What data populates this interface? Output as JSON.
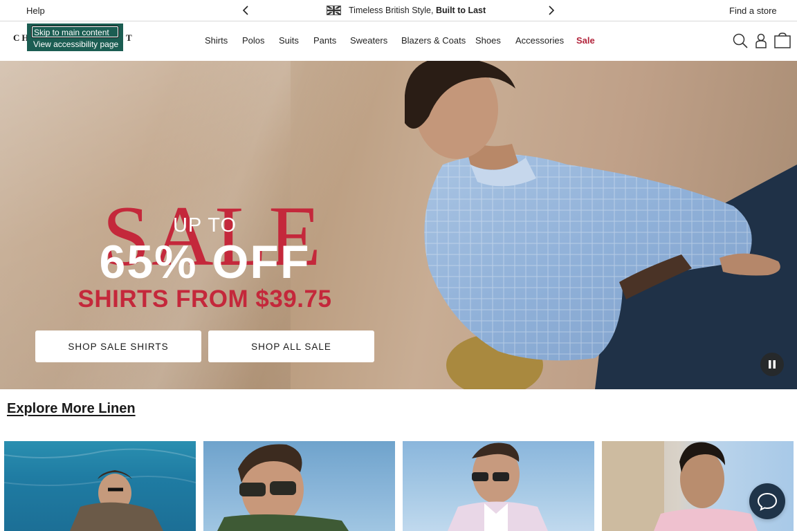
{
  "topbar": {
    "help": "Help",
    "promo_prefix": "Timeless British Style, ",
    "promo_bold": "Built to Last",
    "find_store": "Find a store"
  },
  "header": {
    "logo_start": "CH",
    "logo_end": "T",
    "skip_link": "Skip to main content",
    "accessibility_link": "View accessibility page",
    "nav": [
      "Shirts",
      "Polos",
      "Suits",
      "Pants",
      "Sweaters",
      "Blazers & Coats",
      "Shoes",
      "Accessories",
      "Sale"
    ]
  },
  "hero": {
    "headline": "SALE",
    "up_to": "UP TO",
    "percent": "65% OFF",
    "subline": "SHIRTS FROM $39.75",
    "button_shirts": "SHOP SALE SHIRTS",
    "button_all": "SHOP ALL SALE"
  },
  "explore": {
    "title": "Explore More Linen"
  },
  "colors": {
    "sale_red": "#c4283b",
    "skip_green": "#1b5d52",
    "chat_navy": "#1f3449"
  },
  "icons": [
    "chevron-left-icon",
    "chevron-right-icon",
    "uk-flag-icon",
    "search-icon",
    "account-icon",
    "bag-icon",
    "pause-icon",
    "chat-icon"
  ]
}
